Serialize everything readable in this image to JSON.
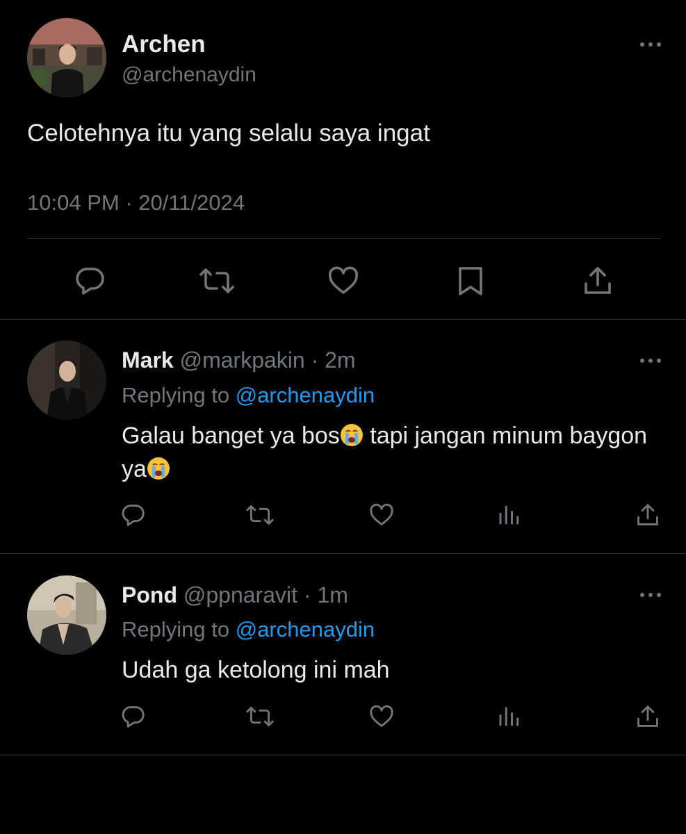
{
  "main_tweet": {
    "author_name": "Archen",
    "author_handle": "@archenaydin",
    "text": "Celotehnya itu yang selalu saya ingat",
    "timestamp": "10:04 PM · 20/11/2024",
    "actions": [
      "reply-icon",
      "retweet-icon",
      "like-icon",
      "bookmark-icon",
      "share-icon"
    ]
  },
  "replies": [
    {
      "name": "Mark",
      "handle": "@markpakin",
      "time": "· 2m",
      "replying_label": "Replying to",
      "replying_to": "@archenaydin",
      "text_part1": "Galau banget ya bos",
      "text_part2": " tapi jangan minum baygon ya",
      "emoji": "loudly-crying-face"
    },
    {
      "name": "Pond",
      "handle": "@ppnaravit",
      "time": "· 1m",
      "replying_label": "Replying to",
      "replying_to": "@archenaydin",
      "text": "Udah ga ketolong ini mah"
    }
  ],
  "colors": {
    "background": "#000000",
    "primary_text": "#e7e9ea",
    "secondary_text": "#71767b",
    "accent": "#1d9bf0",
    "divider": "#2f3336"
  }
}
